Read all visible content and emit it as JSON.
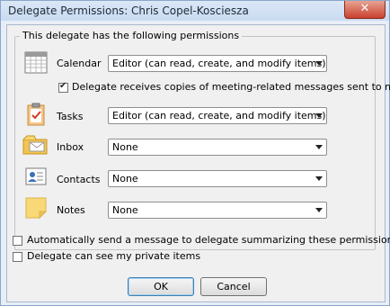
{
  "window": {
    "title": "Delegate Permissions: Chris Copel-Kosciesza",
    "close_label": "✕"
  },
  "group": {
    "title": "This delegate has the following permissions"
  },
  "permissions": [
    {
      "label": "Calendar",
      "icon": "calendar-icon",
      "value": "Editor (can read, create, and modify items)"
    },
    {
      "label": "Tasks",
      "icon": "tasks-icon",
      "value": "Editor (can read, create, and modify items)"
    },
    {
      "label": "Inbox",
      "icon": "inbox-icon",
      "value": "None"
    },
    {
      "label": "Contacts",
      "icon": "contacts-icon",
      "value": "None"
    },
    {
      "label": "Notes",
      "icon": "notes-icon",
      "value": "None"
    }
  ],
  "meeting_copies": {
    "label": "Delegate receives copies of meeting-related messages sent to me",
    "checked": true
  },
  "summary_message": {
    "label": "Automatically send a message to delegate summarizing these permissions",
    "checked": false
  },
  "private_items": {
    "label": "Delegate can see my private items",
    "checked": false
  },
  "buttons": {
    "ok": "OK",
    "cancel": "Cancel"
  }
}
